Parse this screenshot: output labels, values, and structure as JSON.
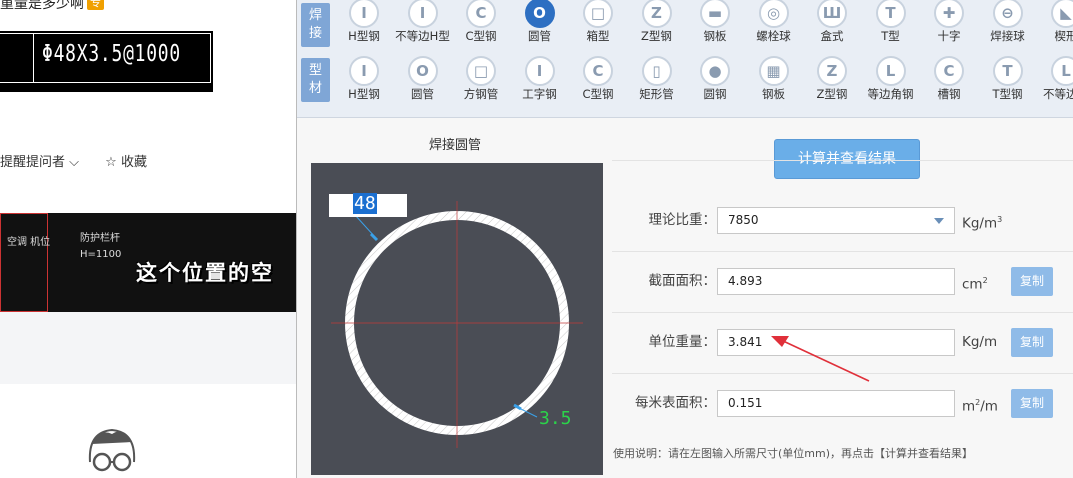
{
  "left_page": {
    "question_title": "重量是多少啊",
    "badge": "专",
    "cad_text": "Φ48X3.5@1000",
    "remind_asker": "提醒提问者",
    "collect": "收藏",
    "cad_image": {
      "label1": "空调\n机位",
      "label2": "防护栏杆",
      "label3": "H=1100",
      "caption": "这个位置的空"
    }
  },
  "tool": {
    "categories": [
      {
        "label_top": "焊",
        "label_bottom": "接"
      },
      {
        "label_top": "型",
        "label_bottom": "材"
      }
    ],
    "welded_row": [
      {
        "label": "H型钢",
        "icon": "I"
      },
      {
        "label": "不等边H型",
        "icon": "I"
      },
      {
        "label": "C型钢",
        "icon": "C"
      },
      {
        "label": "圆管",
        "icon": "O",
        "active": true
      },
      {
        "label": "箱型",
        "icon": "□"
      },
      {
        "label": "Z型钢",
        "icon": "Z"
      },
      {
        "label": "钢板",
        "icon": "▬"
      },
      {
        "label": "螺栓球",
        "icon": "◎"
      },
      {
        "label": "盒式",
        "icon": "Ш"
      },
      {
        "label": "T型",
        "icon": "T"
      },
      {
        "label": "十字",
        "icon": "✚"
      },
      {
        "label": "焊接球",
        "icon": "⊖"
      },
      {
        "label": "楔形",
        "icon": "◣"
      }
    ],
    "profile_row": [
      {
        "label": "H型钢",
        "icon": "I"
      },
      {
        "label": "圆管",
        "icon": "O"
      },
      {
        "label": "方钢管",
        "icon": "□"
      },
      {
        "label": "工字钢",
        "icon": "I"
      },
      {
        "label": "C型钢",
        "icon": "C"
      },
      {
        "label": "矩形管",
        "icon": "▯"
      },
      {
        "label": "圆钢",
        "icon": "●"
      },
      {
        "label": "钢板",
        "icon": "▦"
      },
      {
        "label": "Z型钢",
        "icon": "Z"
      },
      {
        "label": "等边角钢",
        "icon": "L"
      },
      {
        "label": "槽钢",
        "icon": "C"
      },
      {
        "label": "T型钢",
        "icon": "T"
      },
      {
        "label": "不等边角",
        "icon": "L"
      }
    ],
    "diagram": {
      "title": "焊接圆管",
      "outer_diameter": "48",
      "thickness": "3.5"
    },
    "calculate_button": "计算并查看结果",
    "fields": {
      "density": {
        "label": "理论比重：",
        "value": "7850",
        "unit": "Kg/m",
        "unit_sup": "3"
      },
      "area": {
        "label": "截面面积：",
        "value": "4.893",
        "unit": "cm",
        "unit_sup": "2",
        "copy": "复制"
      },
      "unit_weight": {
        "label": "单位重量：",
        "value": "3.841",
        "unit": "Kg/m",
        "copy": "复制"
      },
      "surface": {
        "label": "每米表面积：",
        "value": "0.151",
        "unit_pre": "m",
        "unit_sup": "2",
        "unit_post": "/m",
        "copy": "复制"
      }
    },
    "usage_note": "使用说明：请在左图输入所需尺寸(单位mm)，再点击【计算并查看结果】",
    "colors": {
      "accent": "#2d6fc2",
      "button": "#6aaee8",
      "annotation_arrow": "#e0303a",
      "canvas_bg": "#4a4d55"
    }
  }
}
